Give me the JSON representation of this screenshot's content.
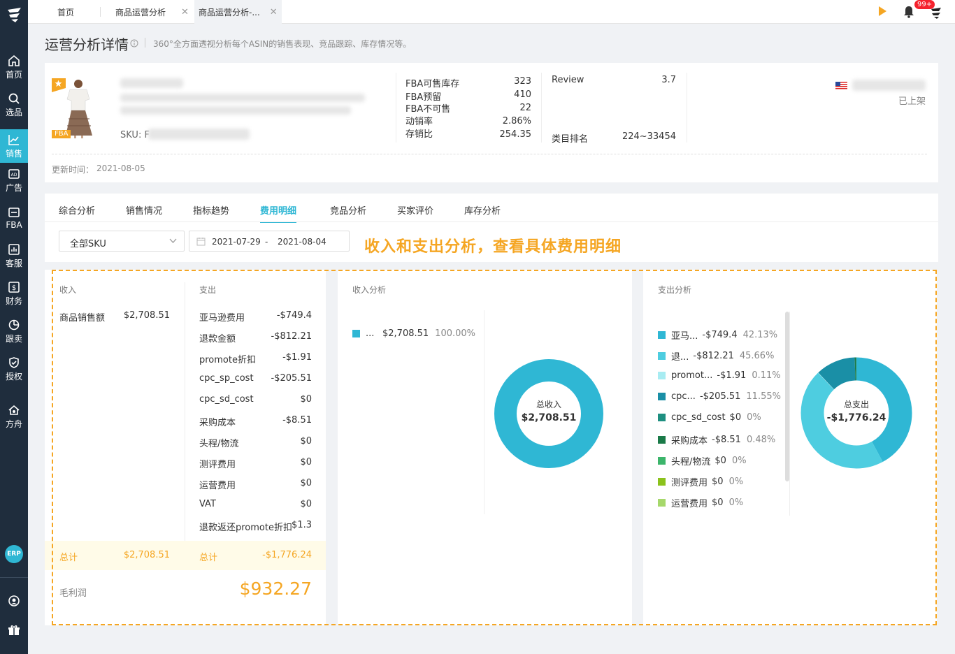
{
  "tabs": [
    {
      "label": "首页"
    },
    {
      "label": "商品运营分析"
    },
    {
      "label": "商品运营分析-..."
    }
  ],
  "notif_badge": "99+",
  "sidebar": {
    "items": [
      {
        "label": "首页",
        "icon": "home-icon"
      },
      {
        "label": "选品",
        "icon": "search-icon"
      },
      {
        "label": "销售",
        "icon": "chart-line-icon"
      },
      {
        "label": "广告",
        "icon": "ad-icon"
      },
      {
        "label": "FBA",
        "icon": "warehouse-icon"
      },
      {
        "label": "客服",
        "icon": "bar-chart-icon"
      },
      {
        "label": "财务",
        "icon": "dollar-icon"
      },
      {
        "label": "跟卖",
        "icon": "pie-icon"
      },
      {
        "label": "授权",
        "icon": "shield-icon"
      },
      {
        "label": "方舟",
        "icon": "ark-icon"
      }
    ],
    "erp": "ERP"
  },
  "page": {
    "title": "运营分析详情",
    "desc": "360°全方面透视分析每个ASIN的销售表现、竞品跟踪、库存情况等。"
  },
  "product": {
    "fba_tag": "FBA",
    "sku_label": "SKU: F",
    "stats": [
      {
        "label": "FBA可售库存",
        "value": "323"
      },
      {
        "label": "FBA预留",
        "value": "410"
      },
      {
        "label": "FBA不可售",
        "value": "22"
      },
      {
        "label": "动销率",
        "value": "2.86%"
      },
      {
        "label": "存销比",
        "value": "254.35"
      }
    ],
    "review_label": "Review",
    "review_value": "3.7",
    "rank_label": "类目排名",
    "rank_value": "224~33454",
    "status": "已上架",
    "updated_label": "更新时间：",
    "updated_value": "2021-08-05"
  },
  "nav_tabs": [
    {
      "label": "综合分析"
    },
    {
      "label": "销售情况"
    },
    {
      "label": "指标趋势"
    },
    {
      "label": "费用明细"
    },
    {
      "label": "竞品分析"
    },
    {
      "label": "买家评价"
    },
    {
      "label": "库存分析"
    }
  ],
  "filters": {
    "sku_select": "全部SKU",
    "date_start": "2021-07-29",
    "date_sep": "-",
    "date_end": "2021-08-04"
  },
  "annotation": "收入和支出分析，查看具体费用明细",
  "income": {
    "title": "收入",
    "rows": [
      {
        "label": "商品销售额",
        "value": "$2,708.51"
      }
    ],
    "total_label": "总计",
    "total_value": "$2,708.51"
  },
  "expense": {
    "title": "支出",
    "rows": [
      {
        "label": "亚马逊费用",
        "value": "-$749.4"
      },
      {
        "label": "退款金额",
        "value": "-$812.21"
      },
      {
        "label": "promote折扣",
        "value": "-$1.91"
      },
      {
        "label": "cpc_sp_cost",
        "value": "-$205.51"
      },
      {
        "label": "cpc_sd_cost",
        "value": "$0"
      },
      {
        "label": "采购成本",
        "value": "-$8.51"
      },
      {
        "label": "头程/物流",
        "value": "$0"
      },
      {
        "label": "测评费用",
        "value": "$0"
      },
      {
        "label": "运营费用",
        "value": "$0"
      },
      {
        "label": "VAT",
        "value": "$0"
      },
      {
        "label": "退款返还promote折扣",
        "value": "$1.3"
      }
    ],
    "total_label": "总计",
    "total_value": "-$1,776.24"
  },
  "profit": {
    "label": "毛利润",
    "value": "$932.27"
  },
  "income_chart": {
    "title": "收入分析",
    "legend": [
      {
        "label": "...",
        "value": "$2,708.51",
        "pct": "100.00%",
        "color": "#2fb7d4"
      }
    ],
    "center_label": "总收入",
    "center_value": "$2,708.51"
  },
  "expense_chart": {
    "title": "支出分析",
    "legend": [
      {
        "label": "亚马...",
        "value": "-$749.4",
        "pct": "42.13%",
        "color": "#2fb7d4"
      },
      {
        "label": "退...",
        "value": "-$812.21",
        "pct": "45.66%",
        "color": "#4ecde0"
      },
      {
        "label": "promot...",
        "value": "-$1.91",
        "pct": "0.11%",
        "color": "#a8ecf2"
      },
      {
        "label": "cpc...",
        "value": "-$205.51",
        "pct": "11.55%",
        "color": "#1a8fa6"
      },
      {
        "label": "cpc_sd_cost",
        "value": "$0",
        "pct": "0%",
        "color": "#1e8f80"
      },
      {
        "label": "采购成本",
        "value": "-$8.51",
        "pct": "0.48%",
        "color": "#1a7a48"
      },
      {
        "label": "头程/物流",
        "value": "$0",
        "pct": "0%",
        "color": "#3cb56b"
      },
      {
        "label": "测评费用",
        "value": "$0",
        "pct": "0%",
        "color": "#8bc21c"
      },
      {
        "label": "运营费用",
        "value": "$0",
        "pct": "0%",
        "color": "#a6d86b"
      }
    ],
    "center_label": "总支出",
    "center_value": "-$1,776.24"
  }
}
